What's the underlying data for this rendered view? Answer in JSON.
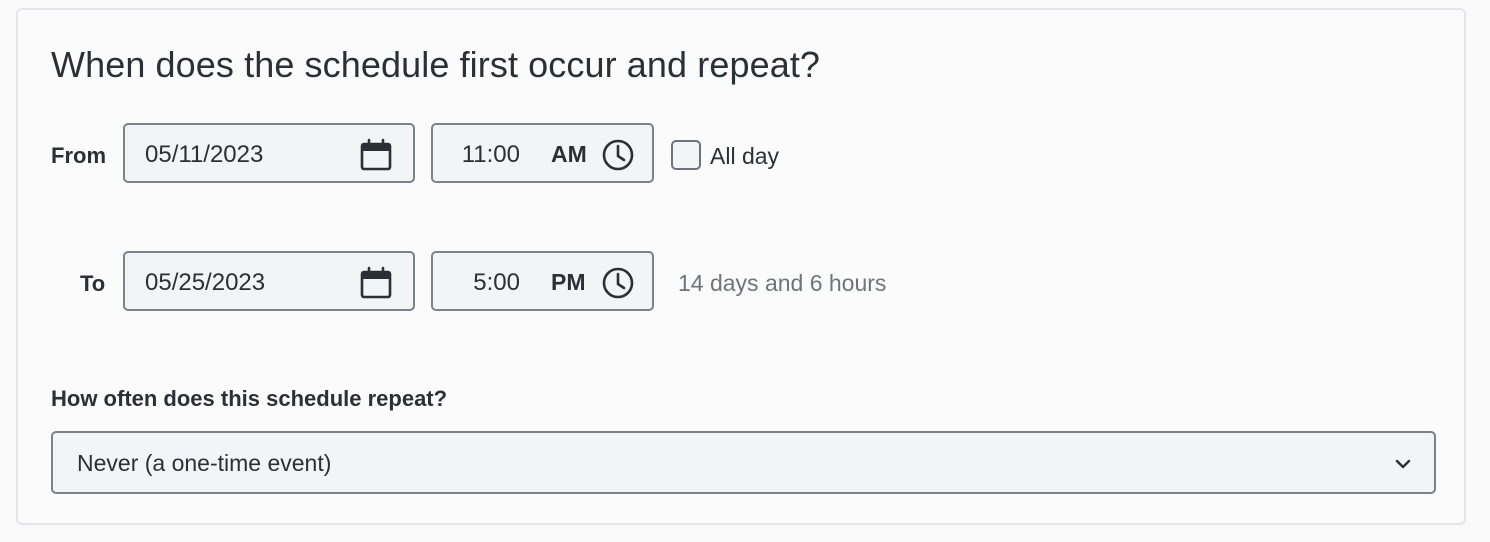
{
  "heading": "When does the schedule first occur and repeat?",
  "from": {
    "label": "From",
    "date": "05/11/2023",
    "time": "11:00",
    "meridiem": "AM",
    "date_icon": "calendar-icon",
    "time_icon": "clock-icon"
  },
  "all_day": {
    "label": "All day",
    "checked": false
  },
  "to": {
    "label": "To",
    "date": "05/25/2023",
    "time": "5:00",
    "meridiem": "PM",
    "date_icon": "calendar-icon",
    "time_icon": "clock-icon"
  },
  "duration": "14 days and 6 hours",
  "repeat": {
    "label": "How often does this schedule repeat?",
    "selected": "Never (a one-time event)",
    "icon": "chevron-down-icon"
  },
  "colors": {
    "text": "#2b2f36",
    "muted_text": "#6e747c",
    "field_border": "#7c828c",
    "field_bg": "#f3f4f6"
  }
}
